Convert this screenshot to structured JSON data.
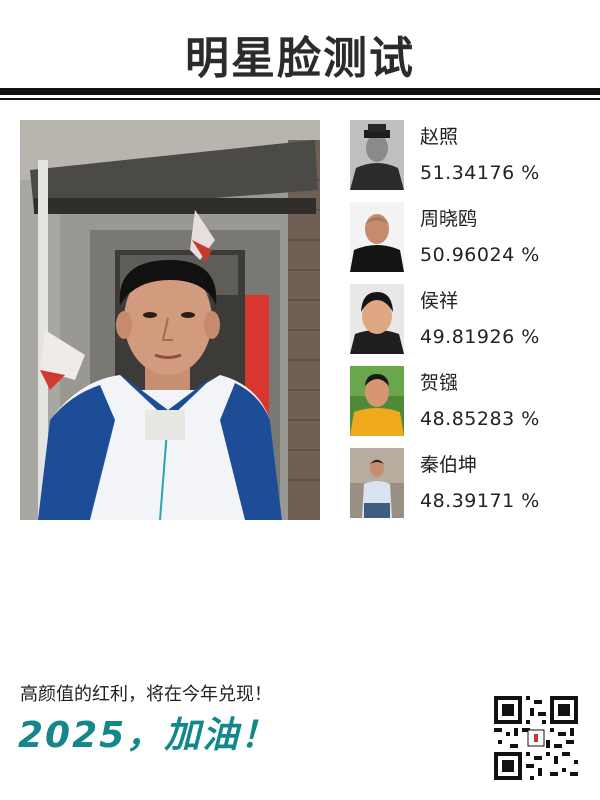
{
  "title": "明星脸测试",
  "main_photo": {
    "icon": "portrait-photo-icon"
  },
  "matches": [
    {
      "name": "赵照",
      "score": "51.34176 %",
      "icon": "celebrity-photo-icon"
    },
    {
      "name": "周晓鸥",
      "score": "50.96024 %",
      "icon": "celebrity-photo-icon"
    },
    {
      "name": "侯祥",
      "score": "49.81926 %",
      "icon": "celebrity-photo-icon"
    },
    {
      "name": "贺镪",
      "score": "48.85283 %",
      "icon": "celebrity-photo-icon"
    },
    {
      "name": "秦伯坤",
      "score": "48.39171 %",
      "icon": "celebrity-photo-icon"
    }
  ],
  "footer": {
    "slogan": "高颜值的红利，将在今年兑现！",
    "cheer": "2025，加油！",
    "qr_icon": "qr-code-icon"
  },
  "colors": {
    "accent": "#13878a",
    "rule": "#111111"
  }
}
